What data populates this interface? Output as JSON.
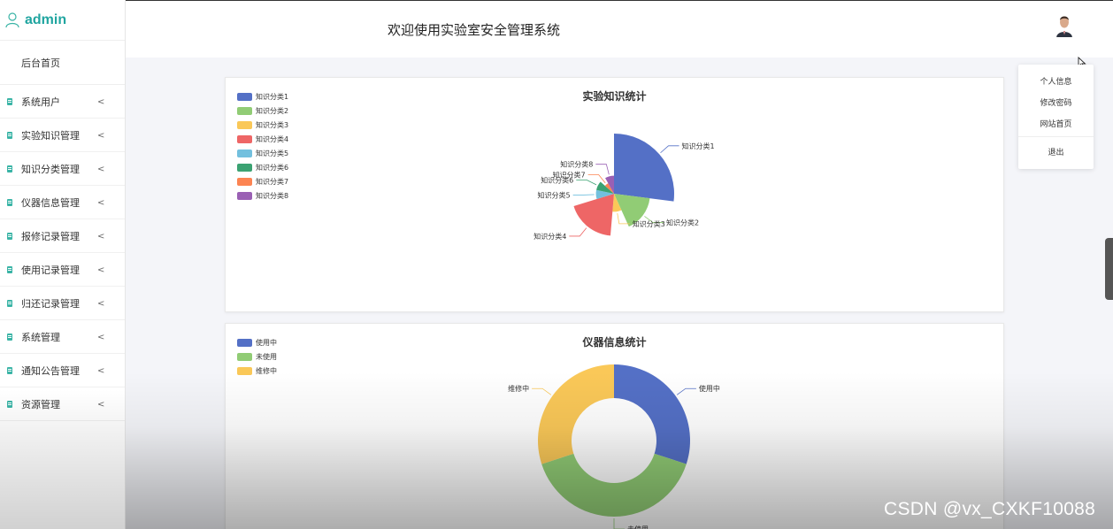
{
  "sidebar": {
    "brand": "admin",
    "home": "后台首页",
    "items": [
      {
        "label": "系统用户"
      },
      {
        "label": "实验知识管理"
      },
      {
        "label": "知识分类管理"
      },
      {
        "label": "仪器信息管理"
      },
      {
        "label": "报修记录管理"
      },
      {
        "label": "使用记录管理"
      },
      {
        "label": "归还记录管理"
      },
      {
        "label": "系统管理"
      },
      {
        "label": "通知公告管理"
      },
      {
        "label": "资源管理"
      }
    ]
  },
  "header": {
    "title": "欢迎使用实验室安全管理系统"
  },
  "user_menu": {
    "items": [
      "个人信息",
      "修改密码",
      "网站首页"
    ],
    "logout": "退出"
  },
  "chart_data": [
    {
      "type": "pie",
      "variant": "rose",
      "title": "实验知识统计",
      "legend": "top-left",
      "categories": [
        "知识分类1",
        "知识分类2",
        "知识分类3",
        "知识分类4",
        "知识分类5",
        "知识分类6",
        "知识分类7",
        "知识分类8"
      ],
      "values": [
        10,
        6,
        3,
        7,
        3,
        3,
        2,
        3
      ],
      "colors": [
        "#5470c6",
        "#91cc75",
        "#fac858",
        "#ee6666",
        "#73c0de",
        "#3ba272",
        "#fc8452",
        "#9a60b4"
      ]
    },
    {
      "type": "pie",
      "variant": "donut",
      "title": "仪器信息统计",
      "legend": "top-left",
      "categories": [
        "使用中",
        "未使用",
        "维修中"
      ],
      "values": [
        3,
        4,
        3
      ],
      "colors": [
        "#5470c6",
        "#91cc75",
        "#fac858"
      ]
    }
  ],
  "watermark": "CSDN @vx_CXKF10088"
}
